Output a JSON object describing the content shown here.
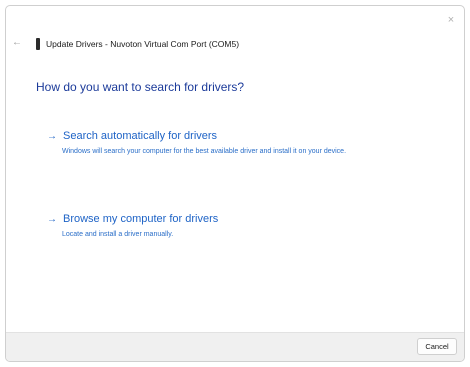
{
  "window": {
    "close_glyph": "×",
    "back_glyph": "←",
    "title": "Update Drivers - Nuvoton Virtual Com Port (COM5)"
  },
  "heading": "How do you want to search for drivers?",
  "options": [
    {
      "arrow": "→",
      "title": "Search automatically for drivers",
      "description": "Windows will search your computer for the best available driver and install it on your device."
    },
    {
      "arrow": "→",
      "title": "Browse my computer for drivers",
      "description": "Locate and install a driver manually."
    }
  ],
  "footer": {
    "cancel_label": "Cancel"
  },
  "colors": {
    "link_blue": "#1e63c6",
    "heading_blue": "#1c3b9a",
    "footer_bg": "#f0f0f0"
  },
  "icons": {
    "close": "close-icon",
    "back": "back-arrow-icon",
    "device": "device-icon",
    "option_arrow": "right-arrow-icon"
  }
}
